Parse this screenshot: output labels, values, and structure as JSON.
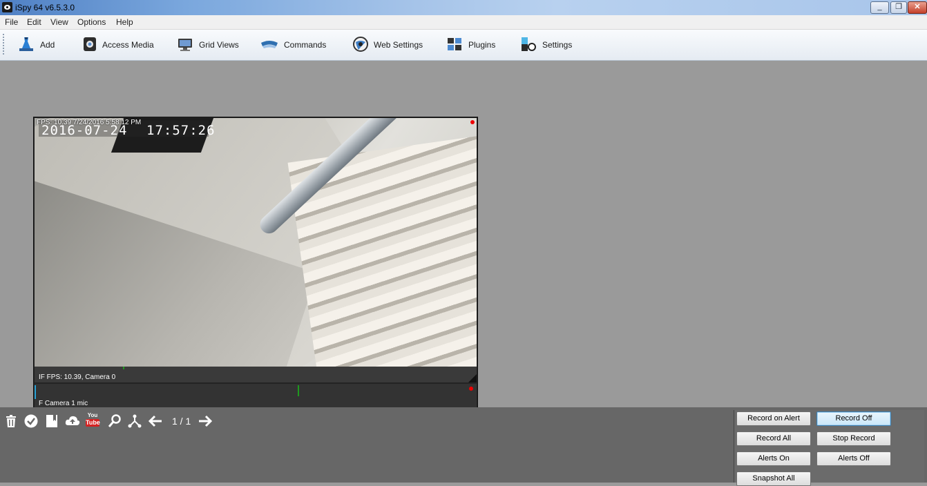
{
  "window": {
    "title": "iSpy 64 v6.5.3.0",
    "controls": [
      "_",
      "❐",
      "✕"
    ]
  },
  "menu": [
    "File",
    "Edit",
    "View",
    "Options",
    "Help"
  ],
  "toolbar": {
    "items": [
      {
        "label": "Add",
        "icon": "add-icon"
      },
      {
        "label": "Access Media",
        "icon": "media-icon"
      },
      {
        "label": "Grid Views",
        "icon": "grid-views-icon"
      },
      {
        "label": "Commands",
        "icon": "commands-icon"
      },
      {
        "label": "Web Settings",
        "icon": "web-settings-icon"
      },
      {
        "label": "Plugins",
        "icon": "plugins-icon"
      },
      {
        "label": "Settings",
        "icon": "settings-icon"
      }
    ]
  },
  "camera": {
    "overlay_info": "FPS: 10.39 7/24/2016 5:58:12 PM",
    "osd_date": "2016-07-24",
    "osd_time": "17:57:26",
    "status_line": "IF  FPS: 10.39, Camera 0",
    "mic_line": "F  Camera 1 mic"
  },
  "bottom": {
    "pager": "1 / 1",
    "icons": [
      "trash-icon",
      "check-icon",
      "bookmark-icon",
      "cloud-upload-icon",
      "youtube-icon",
      "search-icon",
      "hierarchy-icon",
      "arrow-left-icon",
      "arrow-right-icon"
    ],
    "youtube_label": "You\nTube"
  },
  "buttons": {
    "record_on_alert": "Record on Alert",
    "record_off": "Record Off",
    "record_all": "Record All",
    "stop_record": "Stop Record",
    "alerts_on": "Alerts On",
    "alerts_off": "Alerts Off",
    "snapshot_all": "Snapshot All"
  },
  "colors": {
    "workspace": "#9a9a9a",
    "bottom_bar": "#676767",
    "rec_indicator": "#e00000",
    "timeline_marker": "#1e9a1e"
  }
}
